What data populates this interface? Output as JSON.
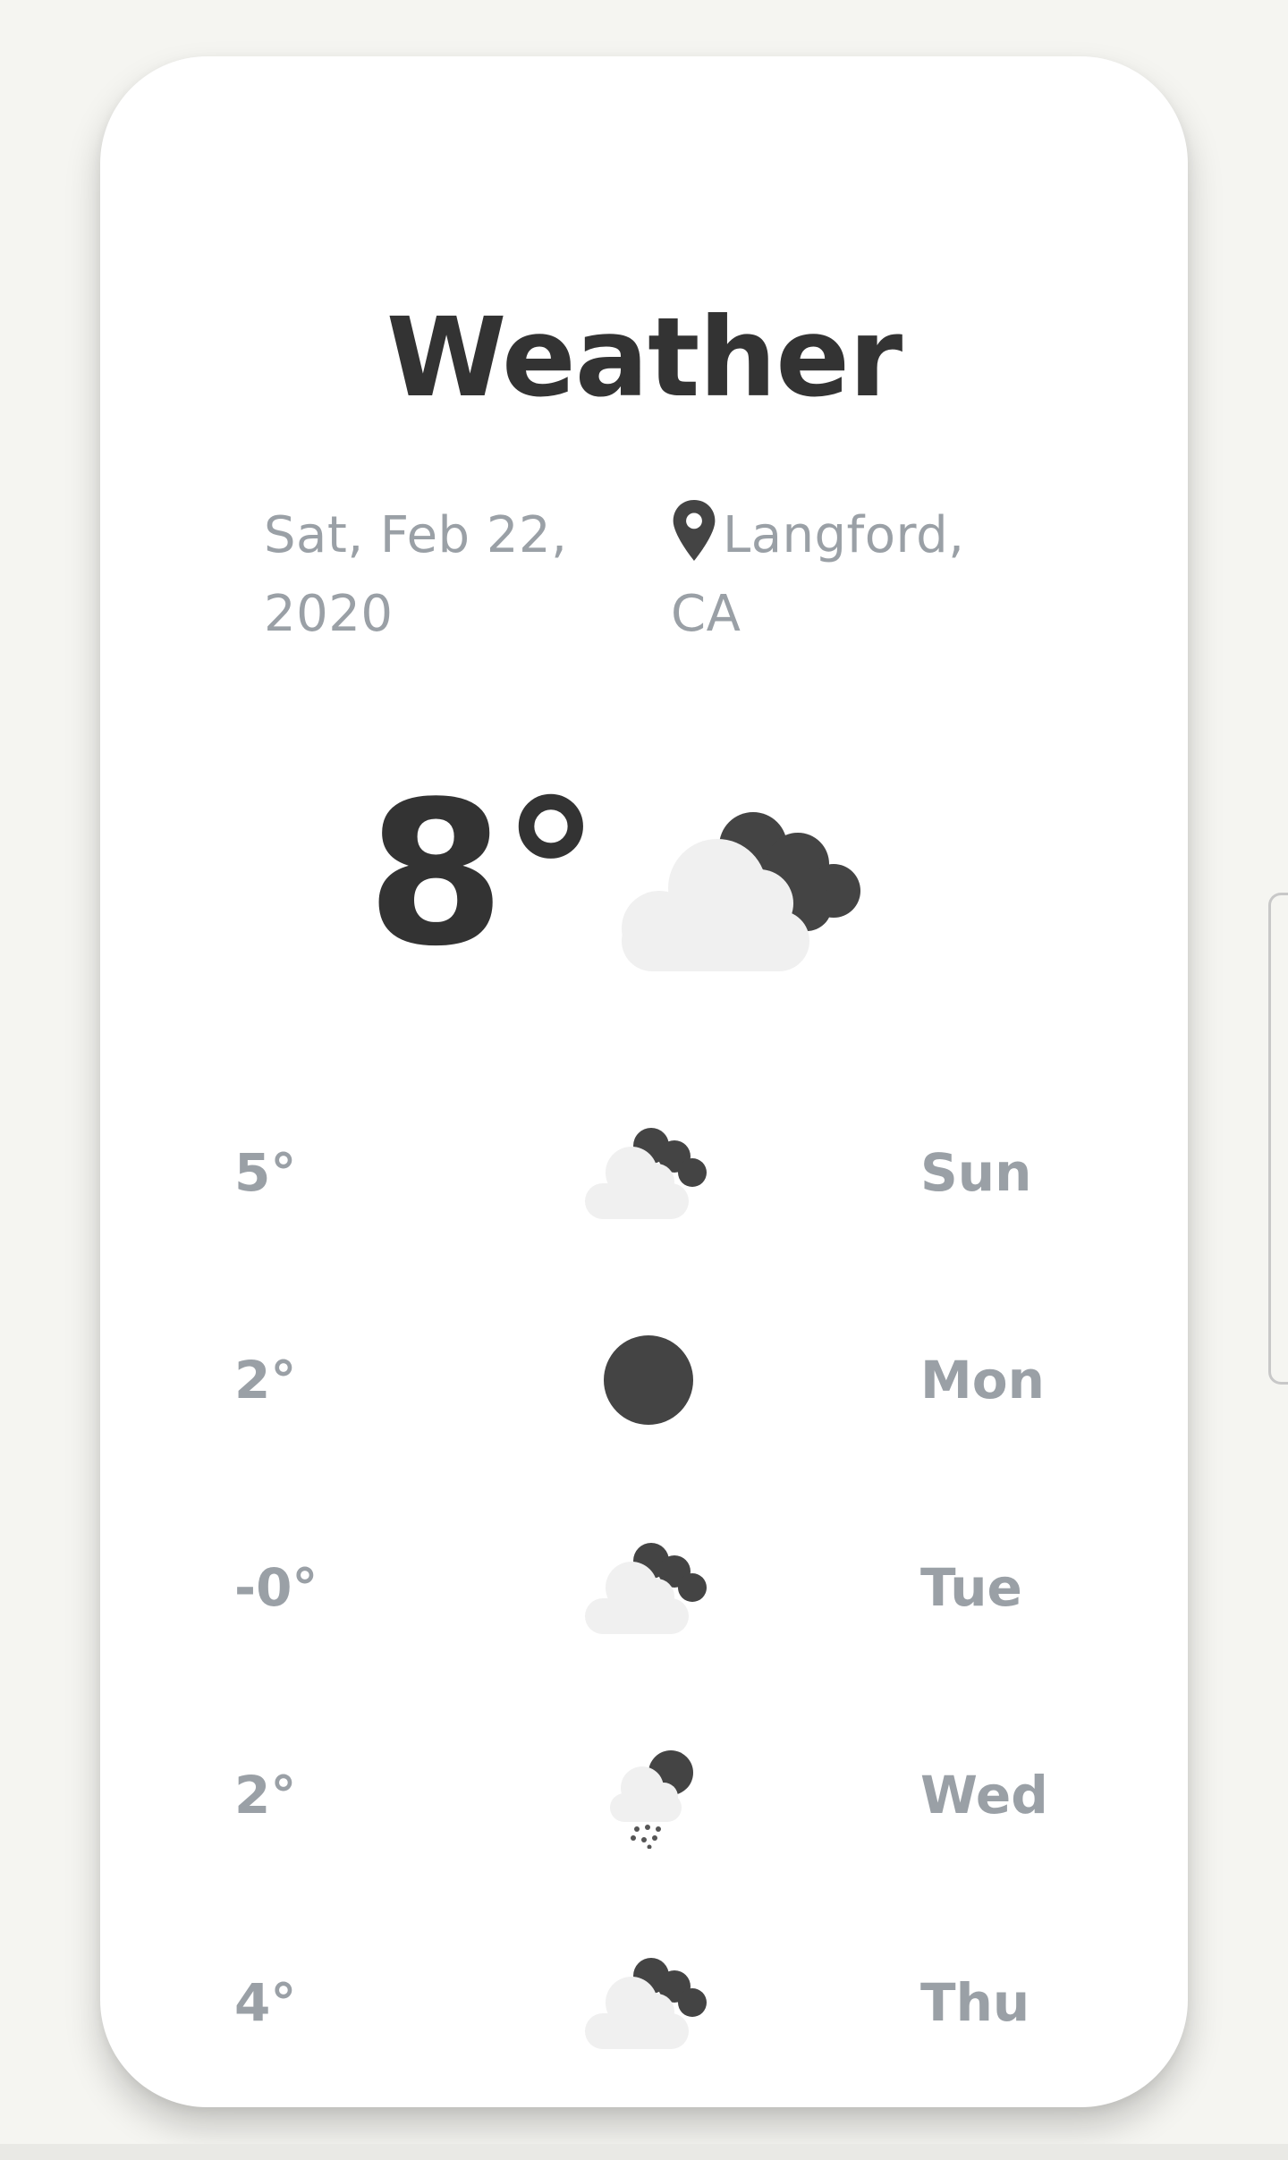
{
  "app": {
    "title": "Weather",
    "date": "Sat, Feb 22, 2020",
    "location": "Langford, CA"
  },
  "current": {
    "temperature": "8°",
    "icon": "cloudy-night-icon"
  },
  "forecast": [
    {
      "temp": "5°",
      "icon": "cloudy-night-icon",
      "day": "Sun"
    },
    {
      "temp": "2°",
      "icon": "clear-night-icon",
      "day": "Mon"
    },
    {
      "temp": "-0°",
      "icon": "cloudy-night-icon",
      "day": "Tue"
    },
    {
      "temp": "2°",
      "icon": "snow-night-icon",
      "day": "Wed"
    },
    {
      "temp": "4°",
      "icon": "cloudy-night-icon",
      "day": "Thu"
    }
  ],
  "colors": {
    "background": "#f5f5f1",
    "card": "#ffffff",
    "text_dark": "#333333",
    "text_muted": "#9aa0a6",
    "icon_dark": "#444444",
    "cloud_light": "#f0f0f0"
  }
}
